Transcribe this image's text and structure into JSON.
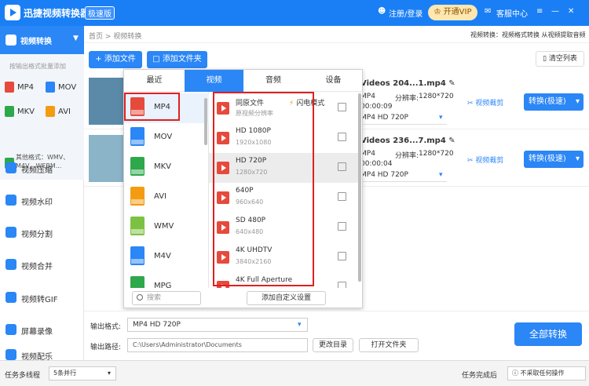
{
  "app": {
    "title": "迅捷视频转换器",
    "badge": "极速版",
    "register": "注册/登录",
    "vip": "开通VIP",
    "service": "客服中心"
  },
  "sidebar": {
    "convert": "视频转换",
    "hint": "按输出格式批量添加",
    "mini_formats": [
      "MP4",
      "MOV",
      "MKV",
      "AVI"
    ],
    "other_formats": [
      "其他格式：WMV、",
      "M4V、WEBM..."
    ],
    "items": [
      "视频压缩",
      "视频水印",
      "视频分割",
      "视频合并",
      "视频转GIF",
      "屏幕录像",
      "视频配乐"
    ]
  },
  "topbar": {
    "home": "首页",
    "sep": ">",
    "current": "视频转换",
    "desc": "视频转换：视频格式转换 从视频提取音频"
  },
  "toolbar": {
    "add_file": "+ 添加文件",
    "add_folder": "添加文件夹",
    "clear": "清空列表"
  },
  "files": [
    {
      "name": "Videos 204...1.mp4",
      "format": "MP4",
      "res_label": "分辨率:",
      "res": "1280*720",
      "time": "00:00:09",
      "preset": "MP4   HD 720P",
      "crop": "视频裁剪",
      "convert": "转换(极速)"
    },
    {
      "name": "Videos 236...7.mp4",
      "format": "MP4",
      "res_label": "分辨率:",
      "res": "1280*720",
      "time": "00:00:04",
      "preset": "MP4   HD 720P",
      "crop": "视频裁剪",
      "convert": "转换(极速)"
    }
  ],
  "popup": {
    "tabs": [
      "最近",
      "视频",
      "音频",
      "设备"
    ],
    "formats": [
      "MP4",
      "MOV",
      "MKV",
      "AVI",
      "WMV",
      "M4V",
      "MPG"
    ],
    "presets": [
      {
        "name": "同原文件",
        "sub": "原视频分辨率"
      },
      {
        "name": "HD 1080P",
        "sub": "1920x1080"
      },
      {
        "name": "HD 720P",
        "sub": "1280x720"
      },
      {
        "name": "640P",
        "sub": "960x640"
      },
      {
        "name": "SD 480P",
        "sub": "640x480"
      },
      {
        "name": "4K UHDTV",
        "sub": "3840x2160"
      },
      {
        "name": "4K Full Aperture",
        "sub": ""
      }
    ],
    "flash": "闪电模式",
    "search": "搜索",
    "add_custom": "添加自定义设置"
  },
  "bottom": {
    "out_format_label": "输出格式:",
    "out_format": "MP4   HD 720P",
    "out_path_label": "输出路径:",
    "out_path": "C:\\Users\\Administrator\\Documents",
    "change_dir": "更改目录",
    "open_folder": "打开文件夹",
    "convert_all": "全部转换"
  },
  "status": {
    "threads_label": "任务多线程",
    "threads": "5条并行",
    "done_label": "任务完成后",
    "done": "不采取任何操作"
  },
  "colors": {
    "brand": "#2b86f6",
    "highlight": "#e02020"
  }
}
